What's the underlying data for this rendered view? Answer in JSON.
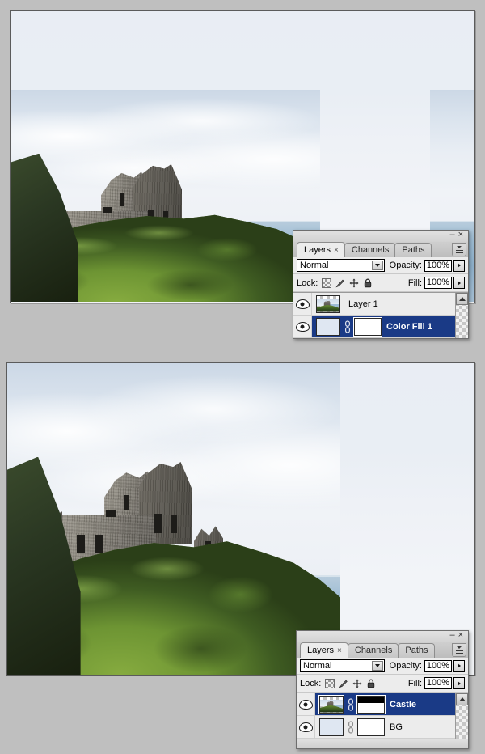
{
  "app": {
    "background_color": "#bfbfbf",
    "canvas_color": "#e9edf4"
  },
  "documents": [
    {
      "id": "doc-top",
      "name": "castle-color-fill-document",
      "description": "Castle photo placed over a solid Color Fill layer; image occupies left portion of canvas"
    },
    {
      "id": "doc-bottom",
      "name": "castle-masked-document",
      "description": "Castle layer with a black-to-white layer mask over a BG layer"
    }
  ],
  "palette_top": {
    "window_controls": {
      "minimize": "–",
      "close": "×"
    },
    "menu_icon": "panel-menu-icon",
    "tabs": [
      {
        "label": "Layers",
        "active": true,
        "closable": true,
        "close_glyph": "×"
      },
      {
        "label": "Channels",
        "active": false,
        "closable": false
      },
      {
        "label": "Paths",
        "active": false,
        "closable": false
      }
    ],
    "blend_mode": "Normal",
    "opacity_label": "Opacity:",
    "opacity_value": "100%",
    "lock_label": "Lock:",
    "lock_icons": [
      "lock-transparency-icon",
      "lock-image-pixels-icon",
      "lock-position-icon",
      "lock-all-icon"
    ],
    "fill_label": "Fill:",
    "fill_value": "100%",
    "layers": [
      {
        "name": "Layer 1",
        "visible": true,
        "selected": false,
        "thumb": "photo",
        "has_mask": false,
        "has_link": false
      },
      {
        "name": "Color Fill 1",
        "visible": true,
        "selected": true,
        "thumb": "solid",
        "thumb_color": "#dfe7f2",
        "has_mask": true,
        "mask_type": "white",
        "has_link": true
      }
    ],
    "selection_color": "#1a3a86"
  },
  "palette_bottom": {
    "window_controls": {
      "minimize": "–",
      "close": "×"
    },
    "menu_icon": "panel-menu-icon",
    "tabs": [
      {
        "label": "Layers",
        "active": true,
        "closable": true,
        "close_glyph": "×"
      },
      {
        "label": "Channels",
        "active": false,
        "closable": false
      },
      {
        "label": "Paths",
        "active": false,
        "closable": false
      }
    ],
    "blend_mode": "Normal",
    "opacity_label": "Opacity:",
    "opacity_value": "100%",
    "lock_label": "Lock:",
    "lock_icons": [
      "lock-transparency-icon",
      "lock-image-pixels-icon",
      "lock-position-icon",
      "lock-all-icon"
    ],
    "fill_label": "Fill:",
    "fill_value": "100%",
    "layers": [
      {
        "name": "Castle",
        "visible": true,
        "selected": true,
        "thumb": "photo",
        "has_mask": true,
        "mask_type": "black-top-white-bottom",
        "has_link": true
      },
      {
        "name": "BG",
        "visible": true,
        "selected": false,
        "thumb": "solid",
        "thumb_color": "#dfe7f2",
        "has_mask": true,
        "mask_type": "white",
        "has_link": true
      }
    ],
    "selection_color": "#1a3a86"
  }
}
